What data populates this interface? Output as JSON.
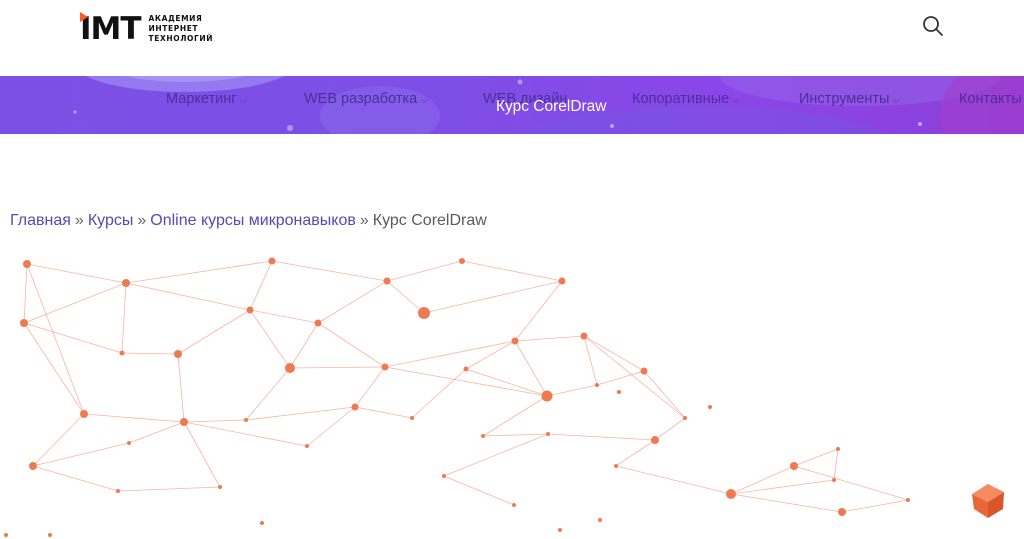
{
  "logo": {
    "mark": "IMT",
    "lines": [
      "АКАДЕМИЯ",
      "ИНТЕРНЕТ",
      "ТЕХНОЛОГИЙ"
    ]
  },
  "header": {
    "search_icon": "search-icon"
  },
  "nav": {
    "items": [
      {
        "label": "Маркетинг"
      },
      {
        "label": "WEB разработка"
      },
      {
        "label": "WEB дизайн"
      },
      {
        "label": "Копоративные"
      },
      {
        "label": "Инструменты"
      },
      {
        "label": "Контакты"
      }
    ]
  },
  "banner": {
    "title": "Курс CorelDraw"
  },
  "breadcrumb": {
    "items": [
      "Главная",
      "Курсы",
      "Online курсы микронавыков"
    ],
    "current": "Курс CorelDraw",
    "separator": "»"
  },
  "colors": {
    "accent": "#7b51e5",
    "link": "#5a47b6",
    "network": "#ef7a52",
    "logo_accent": "#ff5a1f"
  }
}
